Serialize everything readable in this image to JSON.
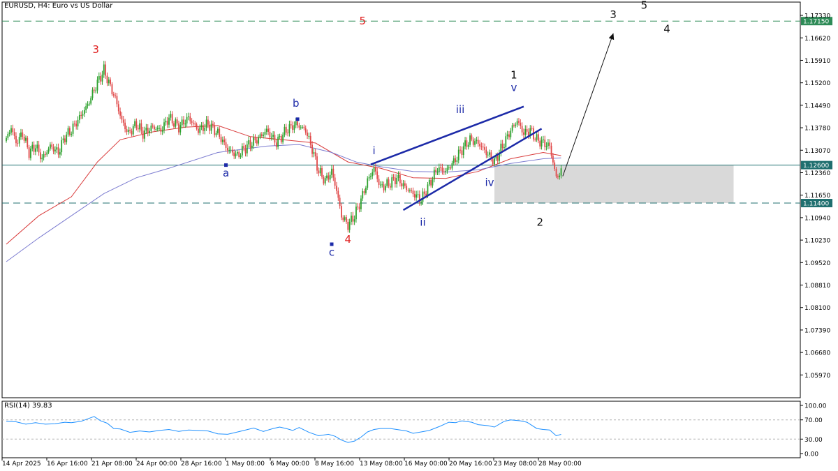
{
  "window": {
    "title": "EURUSD, H4:  Euro vs US Dollar"
  },
  "rsi_panel": {
    "title": "RSI(14) 39.83"
  },
  "chart_data": [
    {
      "type": "candlestick",
      "title": "EURUSD, H4:  Euro vs US Dollar",
      "ylim": [
        1.0525,
        1.1775
      ],
      "y_ticks": [
        "1.17330",
        "1.16620",
        "1.15910",
        "1.15200",
        "1.14490",
        "1.13780",
        "1.13070",
        "1.12360",
        "1.11650",
        "1.10940",
        "1.10230",
        "1.09520",
        "1.08810",
        "1.08100",
        "1.07390",
        "1.06680",
        "1.05970"
      ],
      "x_tick_labels": [
        "14 Apr 2025",
        "16 Apr 16:00",
        "21 Apr 08:00",
        "24 Apr 00:00",
        "28 Apr 16:00",
        "1 May 08:00",
        "6 May 00:00",
        "8 May 16:00",
        "13 May 08:00",
        "16 May 00:00",
        "20 May 16:00",
        "23 May 08:00",
        "28 May 00:00"
      ],
      "price_tags": [
        {
          "value": 1.1715,
          "label": "1.17150",
          "color": "#2e8b57",
          "style": "dashed-green"
        },
        {
          "value": 1.126,
          "label": "1.12600",
          "color": "#1f6f6f",
          "style": "solid-teal"
        },
        {
          "value": 1.114,
          "label": "1.11400",
          "color": "#1f6f6f",
          "style": "dashed-teal"
        }
      ],
      "close_path": [
        [
          0,
          1.134
        ],
        [
          3,
          1.138
        ],
        [
          6,
          1.133
        ],
        [
          10,
          1.136
        ],
        [
          14,
          1.13
        ],
        [
          18,
          1.132
        ],
        [
          22,
          1.128
        ],
        [
          27,
          1.132
        ],
        [
          32,
          1.13
        ],
        [
          36,
          1.135
        ],
        [
          40,
          1.137
        ],
        [
          45,
          1.141
        ],
        [
          50,
          1.145
        ],
        [
          55,
          1.151
        ],
        [
          60,
          1.156
        ],
        [
          63,
          1.152
        ],
        [
          67,
          1.147
        ],
        [
          71,
          1.14
        ],
        [
          75,
          1.136
        ],
        [
          80,
          1.139
        ],
        [
          84,
          1.136
        ],
        [
          90,
          1.138
        ],
        [
          95,
          1.137
        ],
        [
          100,
          1.141
        ],
        [
          106,
          1.138
        ],
        [
          112,
          1.141
        ],
        [
          118,
          1.137
        ],
        [
          124,
          1.139
        ],
        [
          130,
          1.136
        ],
        [
          136,
          1.131
        ],
        [
          142,
          1.129
        ],
        [
          148,
          1.132
        ],
        [
          154,
          1.134
        ],
        [
          160,
          1.137
        ],
        [
          166,
          1.133
        ],
        [
          172,
          1.137
        ],
        [
          178,
          1.139
        ],
        [
          184,
          1.137
        ],
        [
          188,
          1.131
        ],
        [
          192,
          1.124
        ],
        [
          196,
          1.121
        ],
        [
          200,
          1.124
        ],
        [
          203,
          1.118
        ],
        [
          206,
          1.11
        ],
        [
          210,
          1.107
        ],
        [
          214,
          1.11
        ],
        [
          218,
          1.115
        ],
        [
          222,
          1.121
        ],
        [
          226,
          1.125
        ],
        [
          230,
          1.119
        ],
        [
          235,
          1.12
        ],
        [
          240,
          1.122
        ],
        [
          245,
          1.119
        ],
        [
          250,
          1.117
        ],
        [
          255,
          1.115
        ],
        [
          260,
          1.12
        ],
        [
          265,
          1.125
        ],
        [
          270,
          1.124
        ],
        [
          275,
          1.127
        ],
        [
          280,
          1.131
        ],
        [
          285,
          1.134
        ],
        [
          290,
          1.133
        ],
        [
          295,
          1.13
        ],
        [
          300,
          1.127
        ],
        [
          305,
          1.132
        ],
        [
          310,
          1.137
        ],
        [
          314,
          1.14
        ],
        [
          318,
          1.136
        ],
        [
          322,
          1.137
        ],
        [
          326,
          1.134
        ],
        [
          330,
          1.133
        ],
        [
          334,
          1.132
        ],
        [
          336,
          1.127
        ],
        [
          338,
          1.122
        ],
        [
          341,
          1.124
        ]
      ],
      "moving_averages": [
        {
          "color": "#d93b3b",
          "path": [
            [
              0,
              1.101
            ],
            [
              20,
              1.11
            ],
            [
              40,
              1.116
            ],
            [
              56,
              1.127
            ],
            [
              70,
              1.134
            ],
            [
              90,
              1.1365
            ],
            [
              110,
              1.138
            ],
            [
              130,
              1.1385
            ],
            [
              150,
              1.135
            ],
            [
              170,
              1.134
            ],
            [
              190,
              1.133
            ],
            [
              210,
              1.127
            ],
            [
              230,
              1.125
            ],
            [
              250,
              1.122
            ],
            [
              270,
              1.1218
            ],
            [
              290,
              1.124
            ],
            [
              310,
              1.128
            ],
            [
              330,
              1.13
            ],
            [
              341,
              1.129
            ]
          ]
        },
        {
          "color": "#7b7bd0",
          "path": [
            [
              0,
              1.0955
            ],
            [
              20,
              1.103
            ],
            [
              40,
              1.11
            ],
            [
              60,
              1.117
            ],
            [
              80,
              1.122
            ],
            [
              100,
              1.125
            ],
            [
              130,
              1.13
            ],
            [
              160,
              1.132
            ],
            [
              180,
              1.1325
            ],
            [
              200,
              1.13
            ],
            [
              215,
              1.127
            ],
            [
              230,
              1.1255
            ],
            [
              250,
              1.124
            ],
            [
              270,
              1.1238
            ],
            [
              290,
              1.1245
            ],
            [
              310,
              1.1265
            ],
            [
              330,
              1.128
            ],
            [
              341,
              1.1283
            ]
          ]
        }
      ],
      "wave_labels": [
        {
          "text": "3",
          "x": 55,
          "y": 1.1625,
          "color": "#e02020"
        },
        {
          "text": "5",
          "x": 219,
          "y": 1.1715,
          "color": "#e02020"
        },
        {
          "text": "4",
          "x": 210,
          "y": 1.1025,
          "color": "#e02020"
        },
        {
          "text": "a",
          "x": 135,
          "y": 1.1235,
          "color": "#1c2aa8"
        },
        {
          "text": "b",
          "x": 178,
          "y": 1.1455,
          "color": "#1c2aa8"
        },
        {
          "text": "c",
          "x": 200,
          "y": 1.0985,
          "color": "#1c2aa8"
        },
        {
          "text": "i",
          "x": 226,
          "y": 1.1305,
          "color": "#1c2aa8"
        },
        {
          "text": "ii",
          "x": 256,
          "y": 1.108,
          "color": "#1c2aa8"
        },
        {
          "text": "iii",
          "x": 279,
          "y": 1.1435,
          "color": "#1c2aa8"
        },
        {
          "text": "iv",
          "x": 297,
          "y": 1.1205,
          "color": "#1c2aa8"
        },
        {
          "text": "v",
          "x": 312,
          "y": 1.1505,
          "color": "#1c2aa8"
        },
        {
          "text": "1",
          "x": 312,
          "y": 1.1545,
          "color": "#111111"
        },
        {
          "text": "2",
          "x": 328,
          "y": 1.108,
          "color": "#111111"
        },
        {
          "text": "3",
          "x": 373,
          "y": 1.1735,
          "color": "#111111"
        },
        {
          "text": "4",
          "x": 406,
          "y": 1.169,
          "color": "#111111"
        },
        {
          "text": "5",
          "x": 392,
          "y": 1.1765,
          "color": "#111111"
        }
      ],
      "pivot_markers": [
        {
          "x": 135,
          "y": 1.126
        },
        {
          "x": 179,
          "y": 1.1405
        },
        {
          "x": 200,
          "y": 1.101
        }
      ],
      "trendlines": [
        {
          "from": [
            224,
            1.1262
          ],
          "to": [
            318,
            1.1445
          ],
          "color": "#1c2aa8"
        },
        {
          "from": [
            244,
            1.1118
          ],
          "to": [
            329,
            1.1375
          ],
          "color": "#1c2aa8"
        }
      ],
      "projection_arrow": {
        "from": [
          342,
          1.1225
        ],
        "to": [
          373,
          1.1675
        ],
        "color": "#111111"
      },
      "support_zone": {
        "x_from": 300,
        "x_to": 447,
        "y_from": 1.114,
        "y_to": 1.126
      }
    },
    {
      "type": "line",
      "title": "RSI(14) 39.83",
      "ylim": [
        0,
        100
      ],
      "y_ticks": [
        "100.00",
        "70.00",
        "30.00",
        "0.00"
      ],
      "levels": [
        70,
        30
      ],
      "values_path": [
        [
          0,
          67
        ],
        [
          6,
          66
        ],
        [
          12,
          61
        ],
        [
          18,
          64
        ],
        [
          24,
          61
        ],
        [
          30,
          62
        ],
        [
          36,
          65
        ],
        [
          40,
          64
        ],
        [
          46,
          67
        ],
        [
          50,
          72
        ],
        [
          54,
          77
        ],
        [
          58,
          68
        ],
        [
          62,
          63
        ],
        [
          66,
          52
        ],
        [
          70,
          51
        ],
        [
          76,
          44
        ],
        [
          82,
          47
        ],
        [
          88,
          45
        ],
        [
          94,
          48
        ],
        [
          100,
          50
        ],
        [
          106,
          46
        ],
        [
          112,
          49
        ],
        [
          118,
          48
        ],
        [
          124,
          47
        ],
        [
          130,
          41
        ],
        [
          136,
          40
        ],
        [
          140,
          43
        ],
        [
          146,
          48
        ],
        [
          152,
          53
        ],
        [
          158,
          46
        ],
        [
          164,
          52
        ],
        [
          168,
          55
        ],
        [
          172,
          52
        ],
        [
          176,
          48
        ],
        [
          180,
          54
        ],
        [
          186,
          44
        ],
        [
          192,
          37
        ],
        [
          198,
          40
        ],
        [
          202,
          36
        ],
        [
          206,
          28
        ],
        [
          210,
          23
        ],
        [
          214,
          26
        ],
        [
          218,
          34
        ],
        [
          222,
          45
        ],
        [
          226,
          50
        ],
        [
          230,
          52
        ],
        [
          236,
          52
        ],
        [
          240,
          50
        ],
        [
          246,
          47
        ],
        [
          250,
          42
        ],
        [
          255,
          45
        ],
        [
          260,
          48
        ],
        [
          266,
          56
        ],
        [
          272,
          65
        ],
        [
          276,
          64
        ],
        [
          280,
          68
        ],
        [
          286,
          65
        ],
        [
          290,
          60
        ],
        [
          296,
          58
        ],
        [
          300,
          55
        ],
        [
          306,
          67
        ],
        [
          310,
          70
        ],
        [
          316,
          68
        ],
        [
          320,
          65
        ],
        [
          326,
          52
        ],
        [
          330,
          50
        ],
        [
          334,
          49
        ],
        [
          338,
          37
        ],
        [
          341,
          39.83
        ]
      ]
    }
  ]
}
